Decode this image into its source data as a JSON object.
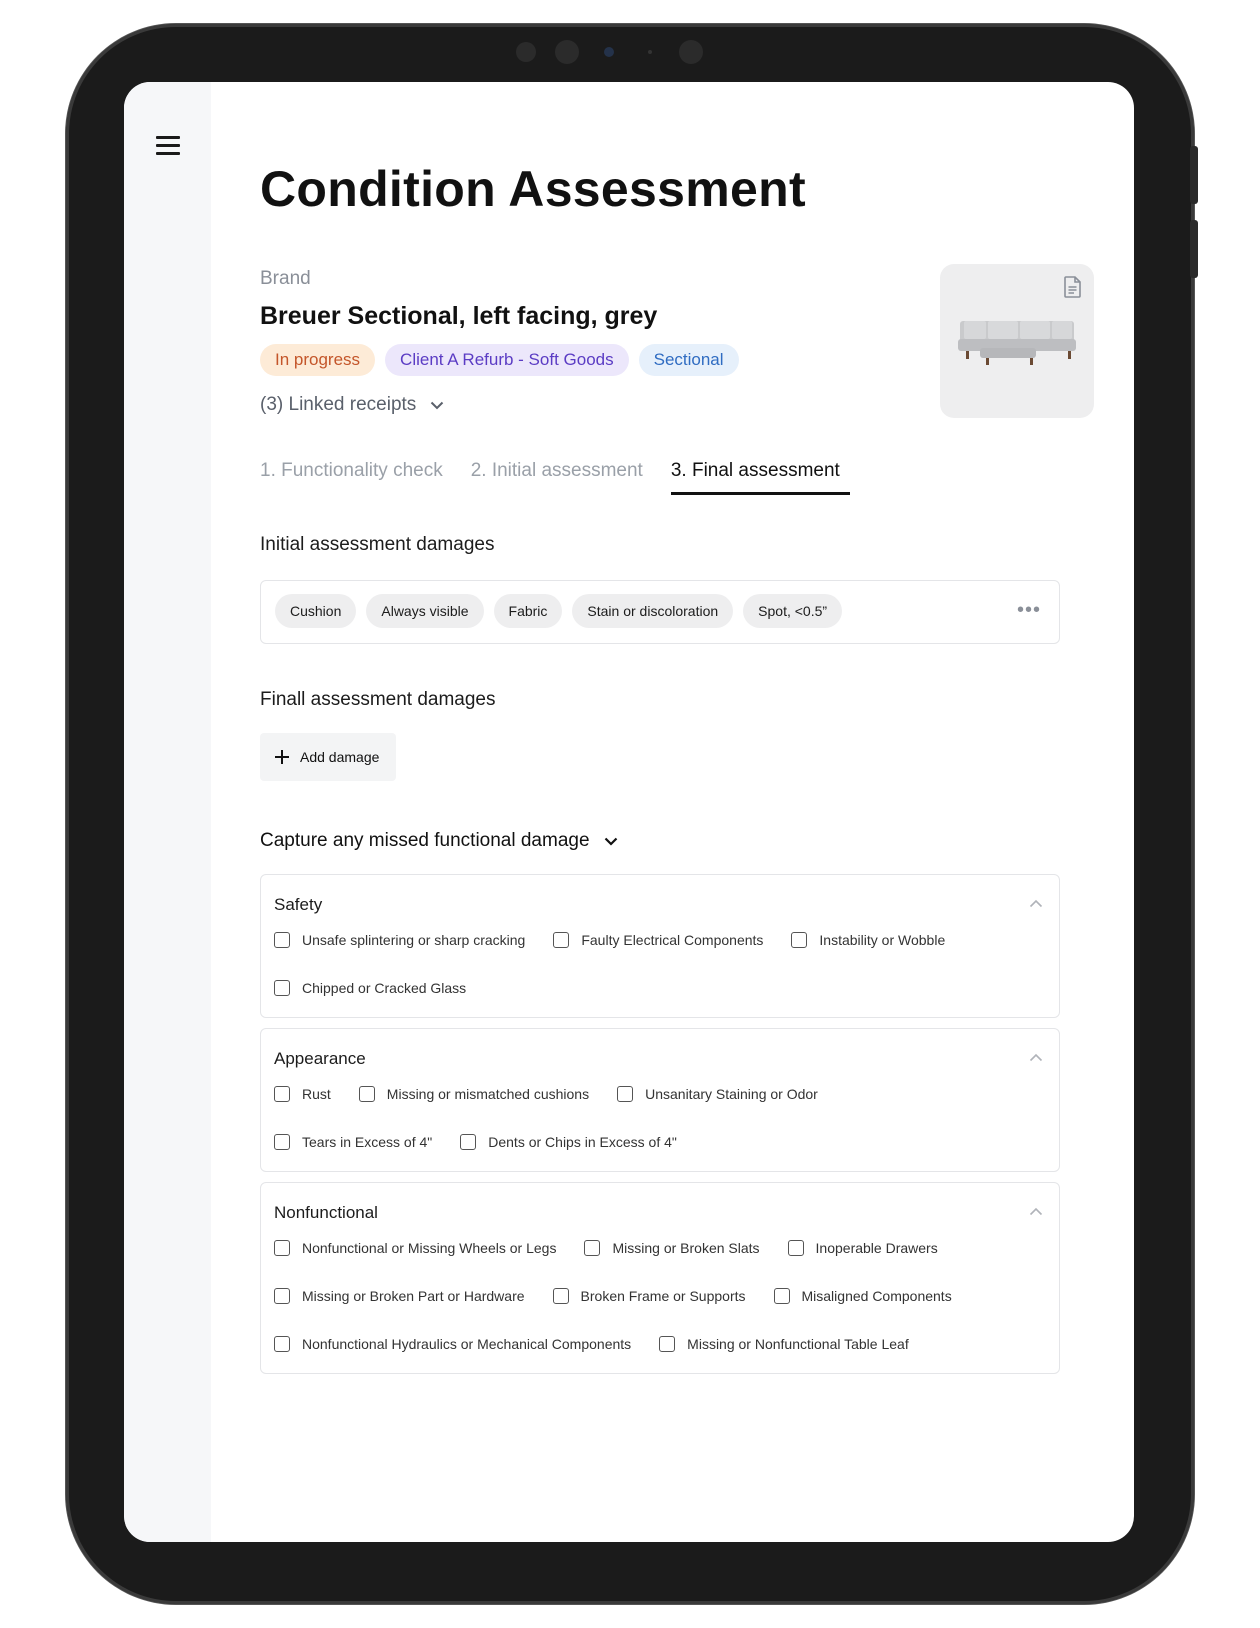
{
  "header": {
    "title": "Condition Assessment"
  },
  "item": {
    "brand_label": "Brand",
    "name": "Breuer Sectional, left facing, grey",
    "badges": [
      "In progress",
      "Client A Refurb - Soft Goods",
      "Sectional"
    ],
    "linked_receipts": "(3) Linked receipts"
  },
  "tabs": [
    "1. Functionality check",
    "2. Initial assessment",
    "3. Final assessment"
  ],
  "active_tab": "3. Final assessment",
  "initial_damages": {
    "heading": "Initial assessment damages",
    "chips": [
      "Cushion",
      "Always visible",
      "Fabric",
      "Stain or discoloration",
      "Spot, <0.5”"
    ]
  },
  "final_damages": {
    "heading": "Finall assessment damages",
    "add_label": "Add damage"
  },
  "capture": {
    "label": "Capture any missed functional damage"
  },
  "groups": [
    {
      "title": "Safety",
      "rows": [
        [
          "Unsafe splintering or sharp cracking",
          "Faulty Electrical Components",
          "Instability or Wobble"
        ],
        [
          "Chipped or Cracked Glass"
        ]
      ]
    },
    {
      "title": "Appearance",
      "rows": [
        [
          "Rust",
          "Missing or mismatched cushions",
          "Unsanitary Staining or Odor"
        ],
        [
          "Tears in Excess of 4\"",
          "Dents or Chips in Excess of 4\""
        ]
      ]
    },
    {
      "title": "Nonfunctional",
      "rows": [
        [
          "Nonfunctional or Missing Wheels or Legs",
          "Missing or Broken Slats",
          "Inoperable Drawers"
        ],
        [
          "Missing or Broken Part or Hardware",
          "Broken Frame or Supports",
          "Misaligned Components"
        ],
        [
          "Nonfunctional Hydraulics or Mechanical Components",
          "Missing or Nonfunctional Table Leaf"
        ]
      ]
    }
  ],
  "colors": {
    "progress_bg": "#fdebd7",
    "progress_fg": "#c4562a",
    "client_bg": "#ece7fb",
    "client_fg": "#5b3cc4",
    "type_bg": "#e6f0fb",
    "type_fg": "#2f6cc2"
  }
}
